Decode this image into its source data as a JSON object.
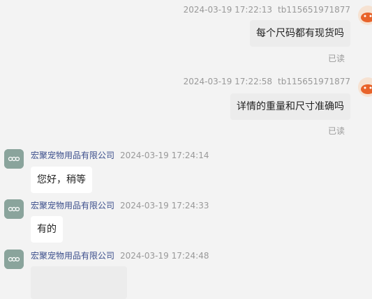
{
  "messages_self": [
    {
      "timestamp": "2024-03-19 17:22:13",
      "user": "tb115651971877",
      "text": "每个尺码都有现货吗",
      "status": "已读"
    },
    {
      "timestamp": "2024-03-19 17:22:58",
      "user": "tb115651971877",
      "text": "详情的重量和尺寸准确吗",
      "status": "已读"
    }
  ],
  "messages_other": [
    {
      "sender": "宏聚宠物用品有限公司",
      "timestamp": "2024-03-19 17:24:14",
      "text": "您好，稍等"
    },
    {
      "sender": "宏聚宠物用品有限公司",
      "timestamp": "2024-03-19 17:24:33",
      "text": "有的"
    },
    {
      "sender": "宏聚宠物用品有限公司",
      "timestamp": "2024-03-19 17:24:48",
      "text": ""
    }
  ],
  "colors": {
    "sender_name": "#3c4f8c",
    "timestamp": "#999999",
    "self_bubble": "#ececec",
    "other_bubble": "#ffffff"
  }
}
